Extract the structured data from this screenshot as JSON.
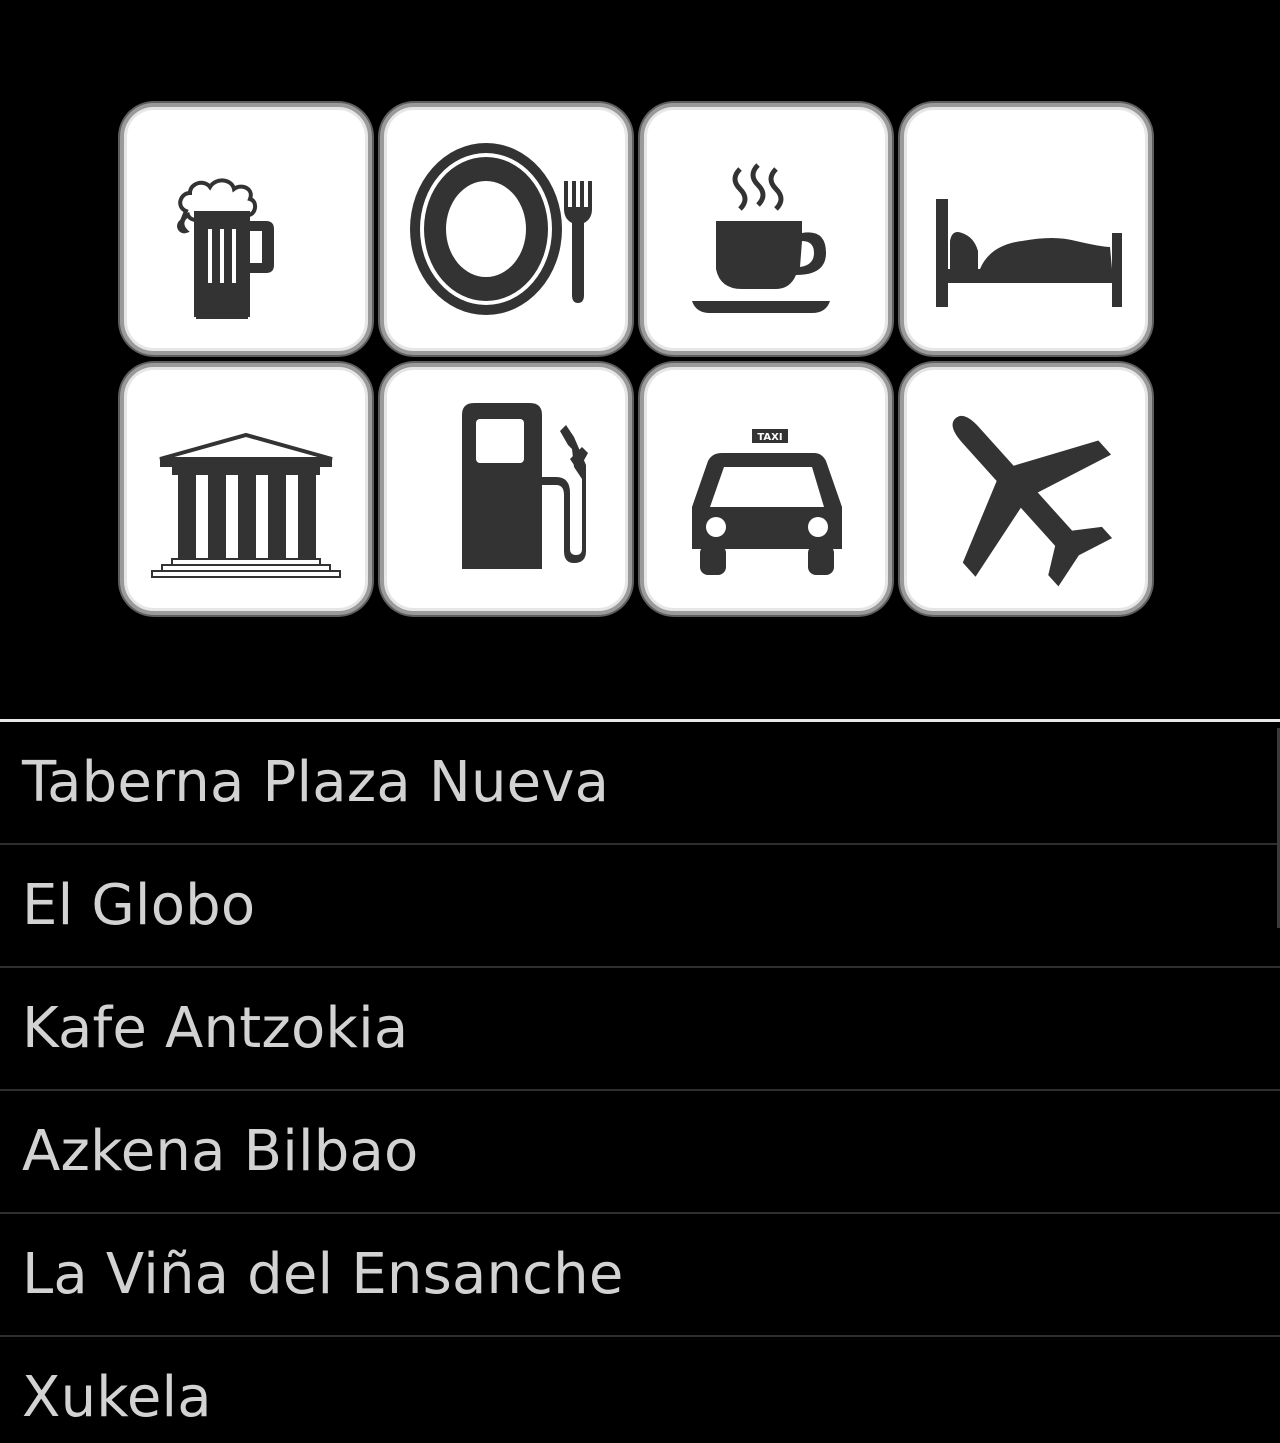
{
  "colors": {
    "background": "#000000",
    "tile_background": "#ffffff",
    "tile_border": "#9a9a9a",
    "icon_fill": "#333333",
    "list_text": "#d2d2d2",
    "list_separator": "#2e2e2e",
    "divider": "#e8e8e8"
  },
  "categories": [
    {
      "icon": "beer-mug-icon"
    },
    {
      "icon": "plate-fork-knife-icon"
    },
    {
      "icon": "coffee-cup-icon"
    },
    {
      "icon": "bed-icon"
    },
    {
      "icon": "museum-icon"
    },
    {
      "icon": "gas-pump-icon"
    },
    {
      "icon": "taxi-icon",
      "sign_text": "TAXI"
    },
    {
      "icon": "airplane-icon"
    }
  ],
  "places": [
    {
      "name": "Taberna Plaza Nueva"
    },
    {
      "name": "El Globo"
    },
    {
      "name": "Kafe Antzokia"
    },
    {
      "name": "Azkena Bilbao"
    },
    {
      "name": "La Viña del Ensanche"
    },
    {
      "name": "Xukela"
    }
  ]
}
